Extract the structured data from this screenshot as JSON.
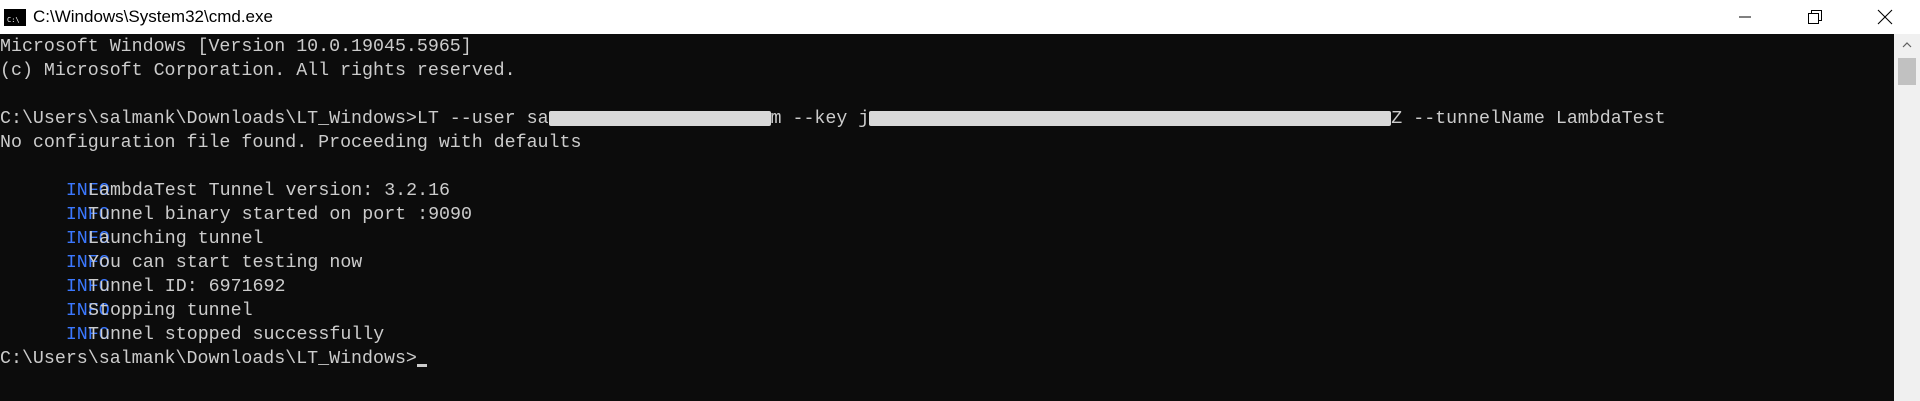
{
  "window": {
    "title": "C:\\Windows\\System32\\cmd.exe",
    "icon": "cmd-console-icon",
    "controls": [
      "minimize-icon",
      "maximize-icon",
      "close-icon"
    ]
  },
  "console": {
    "line1": "Microsoft Windows [Version 10.0.19045.5965]",
    "line2": "(c) Microsoft Corporation. All rights reserved.",
    "command": {
      "prompt": "C:\\Users\\salmank\\Downloads\\LT_Windows>",
      "part1": "LT --user sa",
      "part2": "m --key j",
      "part3": "Z --tunnelName LambdaTest"
    },
    "no_config": "No configuration file found. Proceeding with defaults",
    "info_label": "INFO",
    "info_lines": [
      "LambdaTest Tunnel version: 3.2.16",
      "Tunnel binary started on port :9090",
      "Launching tunnel",
      "You can start testing now",
      "Tunnel ID: 6971692",
      "Stopping tunnel",
      "Tunnel stopped successfully"
    ],
    "final_prompt": "C:\\Users\\salmank\\Downloads\\LT_Windows>"
  },
  "colors": {
    "background": "#0c0c0c",
    "text": "#cccccc",
    "info": "#3b78ff",
    "redaction": "#d9d9d9"
  }
}
